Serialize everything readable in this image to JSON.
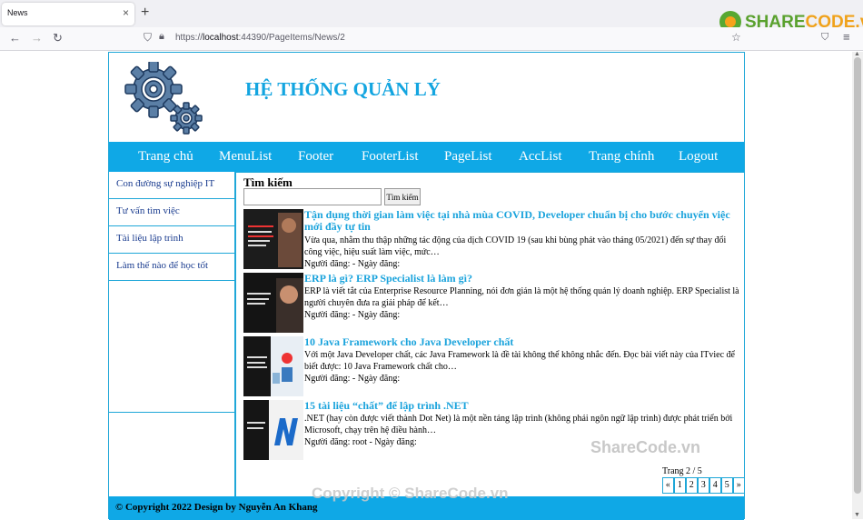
{
  "browser": {
    "tab_title": "News",
    "tab_close": "×",
    "new_tab": "+",
    "url_scheme": "https://",
    "url_host": "localhost",
    "url_path": ":44390/PageItems/News/2",
    "logo_share": "SHARE",
    "logo_code": "CODE.vn"
  },
  "site": {
    "title": "HỆ THỐNG QUẢN LÝ",
    "menu": [
      "Trang chủ",
      "MenuList",
      "Footer",
      "FooterList",
      "PageList",
      "AccList",
      "Trang chính",
      "Logout"
    ],
    "sidebar": [
      "Con đường sự nghiệp IT",
      "Tư vấn tìm việc",
      "Tài liệu lập trình",
      "Làm thế nào để học tốt"
    ],
    "search": {
      "label": "Tìm kiếm",
      "value": "",
      "button": "Tìm kiếm"
    },
    "posts": [
      {
        "title": "Tận dụng thời gian làm việc tại nhà mùa COVID, Developer chuẩn bị cho bước chuyển việc mới đầy tự tin",
        "excerpt": "Vừa qua, nhằm thu thập những tác động của dịch COVID 19 (sau khi bùng phát vào tháng 05/2021) đến sự thay đổi công việc, hiệu suất làm việc, mức…",
        "meta": "Người đăng: - Ngày đăng:"
      },
      {
        "title": "ERP là gì? ERP Specialist là làm gì?",
        "excerpt": "ERP là viết tắt của Enterprise Resource Planning, nói đơn giản là một hệ thống quản lý doanh nghiệp. ERP Specialist là người chuyên đưa ra giải pháp để kết…",
        "meta": "Người đăng: - Ngày đăng:"
      },
      {
        "title": "10 Java Framework cho Java Developer chất",
        "excerpt": "Với một Java Developer chất, các Java Framework là đề tài không thể không nhắc đến. Đọc bài viết này của ITviec để biết được: 10 Java Framework chất cho…",
        "meta": "Người đăng: - Ngày đăng:"
      },
      {
        "title": "15 tài liệu “chất” để lập trình .NET",
        "excerpt": ".NET (hay còn được viết thành Dot Net) là một nền tảng lập trình (không phải ngôn ngữ lập trình) được phát triển bởi Microsoft, chạy trên hệ điều hành…",
        "meta": "Người đăng: root - Ngày đăng:"
      }
    ],
    "pager": {
      "label": "Trang 2 / 5",
      "items": [
        "«",
        "1",
        "2",
        "3",
        "4",
        "5",
        "»"
      ]
    },
    "footer": "© Copyright 2022 Design by Nguyễn An Khang"
  },
  "watermarks": {
    "mid": "ShareCode.vn",
    "bottom": "Copyright © ShareCode.vn"
  },
  "colors": {
    "accent": "#0fa8e6",
    "title": "#13a5e0",
    "link": "#1aa3dc"
  }
}
